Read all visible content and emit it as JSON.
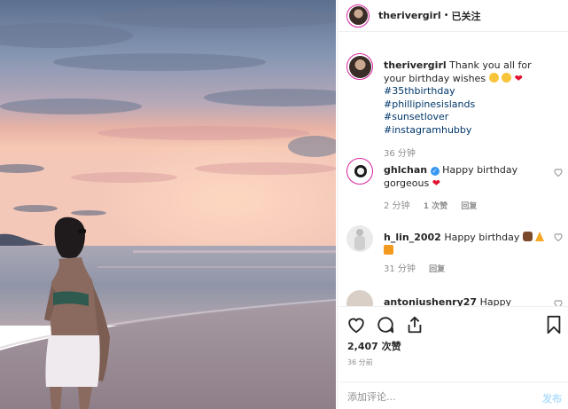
{
  "header": {
    "username": "theriverg irl",
    "separator": "•",
    "follow_label": "已关注"
  },
  "caption": {
    "username": "therivergirl",
    "text": "Thank you all for your birthday wishes",
    "hashtags": [
      "#35thbirthday",
      "#phillipinesislands",
      "#sunsetlover",
      "#instagramhubby"
    ],
    "time": "36 分钟"
  },
  "comments": [
    {
      "username": "ghlchan",
      "text": "Happy birthday gorgeous",
      "time": "2 分钟",
      "likes": "1 次赞",
      "reply": "回复"
    },
    {
      "username": "h_lin_2002",
      "text": "Happy birthday",
      "time": "31 分钟",
      "reply": "回复"
    },
    {
      "username": "antoniushenry27",
      "text": "Happy Birthday"
    }
  ],
  "footer": {
    "likes": "2,407 次赞",
    "timestamp": "36 分前",
    "comment_placeholder": "添加评论...",
    "post_label": "发布"
  },
  "icons": {
    "like": "heart-icon",
    "comment": "speech-bubble-icon",
    "share": "share-icon",
    "save": "bookmark-icon"
  }
}
